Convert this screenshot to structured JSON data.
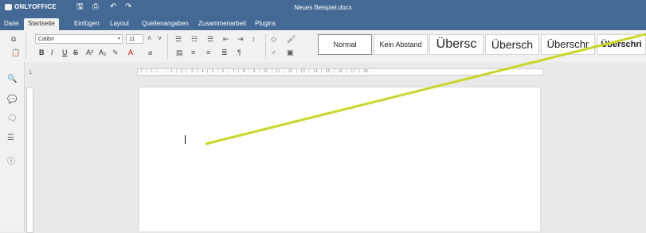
{
  "app": {
    "brand": "ONLYOFFICE",
    "doc_title": "Neues Beispiel.docx"
  },
  "title_icons": [
    "save-icon",
    "print-icon",
    "undo-icon",
    "redo-icon"
  ],
  "menu": {
    "tabs": [
      {
        "label": "Datei"
      },
      {
        "label": "Startseite"
      },
      {
        "label": "Einfügen"
      },
      {
        "label": "Layout"
      },
      {
        "label": "Quellenangaben"
      },
      {
        "label": "Zusammenarbeit"
      },
      {
        "label": "Plugins"
      }
    ],
    "active_tab": "Startseite"
  },
  "toolbar": {
    "font_name": "Calibri",
    "font_size": "11",
    "bold": "B",
    "italic": "I",
    "underline": "U",
    "strike": "S",
    "superscript": "A²",
    "subscript": "A₂"
  },
  "styles": [
    {
      "label": "Normal",
      "selected": true
    },
    {
      "label": "Kein Abstand"
    },
    {
      "label": "Übersc"
    },
    {
      "label": "Übersch"
    },
    {
      "label": "Überschr"
    },
    {
      "label": "Überschri"
    }
  ],
  "ruler": {
    "marks": "· 2 · | · 1 · | · · · | · 1 · | · 2 · | · 3 · | · 4 · | · 5 · | · 6 · | · 7 · | · 8 · | · 9 · | · 10 · | · 11 · | · 12 · | · 13 · | · 14 · | · 15 · | · 16 · | · 17 · | · 18 ·"
  },
  "colors": {
    "header": "#446995",
    "annotation_line": "#c8d62a"
  }
}
